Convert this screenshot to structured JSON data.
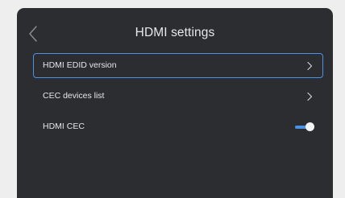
{
  "header": {
    "title": "HDMI settings",
    "back_icon": "chevron-left-icon"
  },
  "menu": {
    "items": [
      {
        "label": "HDMI EDID version",
        "control": "chevron-right-icon",
        "focused": true
      },
      {
        "label": "CEC devices list",
        "control": "chevron-right-icon",
        "focused": false
      },
      {
        "label": "HDMI CEC",
        "control": "toggle",
        "toggle_state": "on"
      }
    ]
  },
  "colors": {
    "background": "#2b2d31",
    "accent": "#4a93e4",
    "text": "#e6e6e6"
  }
}
